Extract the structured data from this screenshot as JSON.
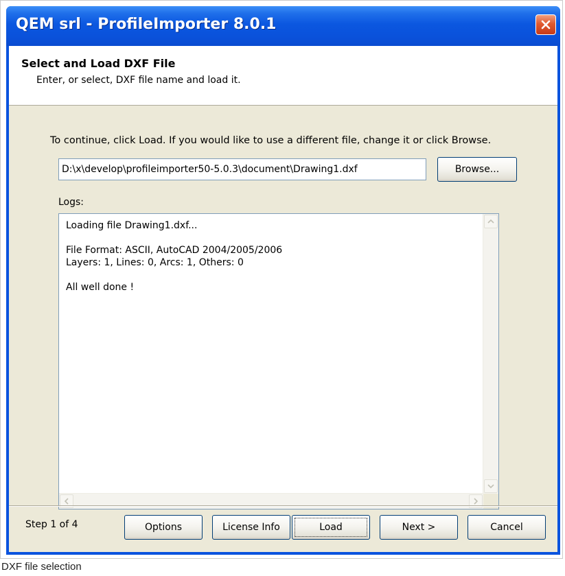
{
  "window": {
    "title": "QEM srl - ProfileImporter 8.0.1",
    "close_icon": "close-icon"
  },
  "header": {
    "title": "Select and Load DXF File",
    "subtitle": "Enter, or select, DXF file name and load it."
  },
  "main": {
    "instruction": "To continue, click Load. If you would like to use a different file, change it or click Browse.",
    "file_path": "D:\\x\\develop\\profileimporter50-5.0.3\\document\\Drawing1.dxf",
    "browse_label": "Browse...",
    "logs_label": "Logs:",
    "logs_text": "Loading file Drawing1.dxf...\n\nFile Format: ASCII, AutoCAD 2004/2005/2006\nLayers: 1, Lines: 0, Arcs: 1, Others: 0\n\nAll well done !"
  },
  "footer": {
    "step": "Step 1 of 4",
    "buttons": {
      "options": "Options",
      "license": "License Info",
      "load": "Load",
      "next": "Next >",
      "cancel": "Cancel"
    }
  },
  "caption": "DXF file selection",
  "colors": {
    "titlebar": "#0a53de",
    "dialog_bg": "#ece9d8",
    "close_button": "#e15a30"
  }
}
